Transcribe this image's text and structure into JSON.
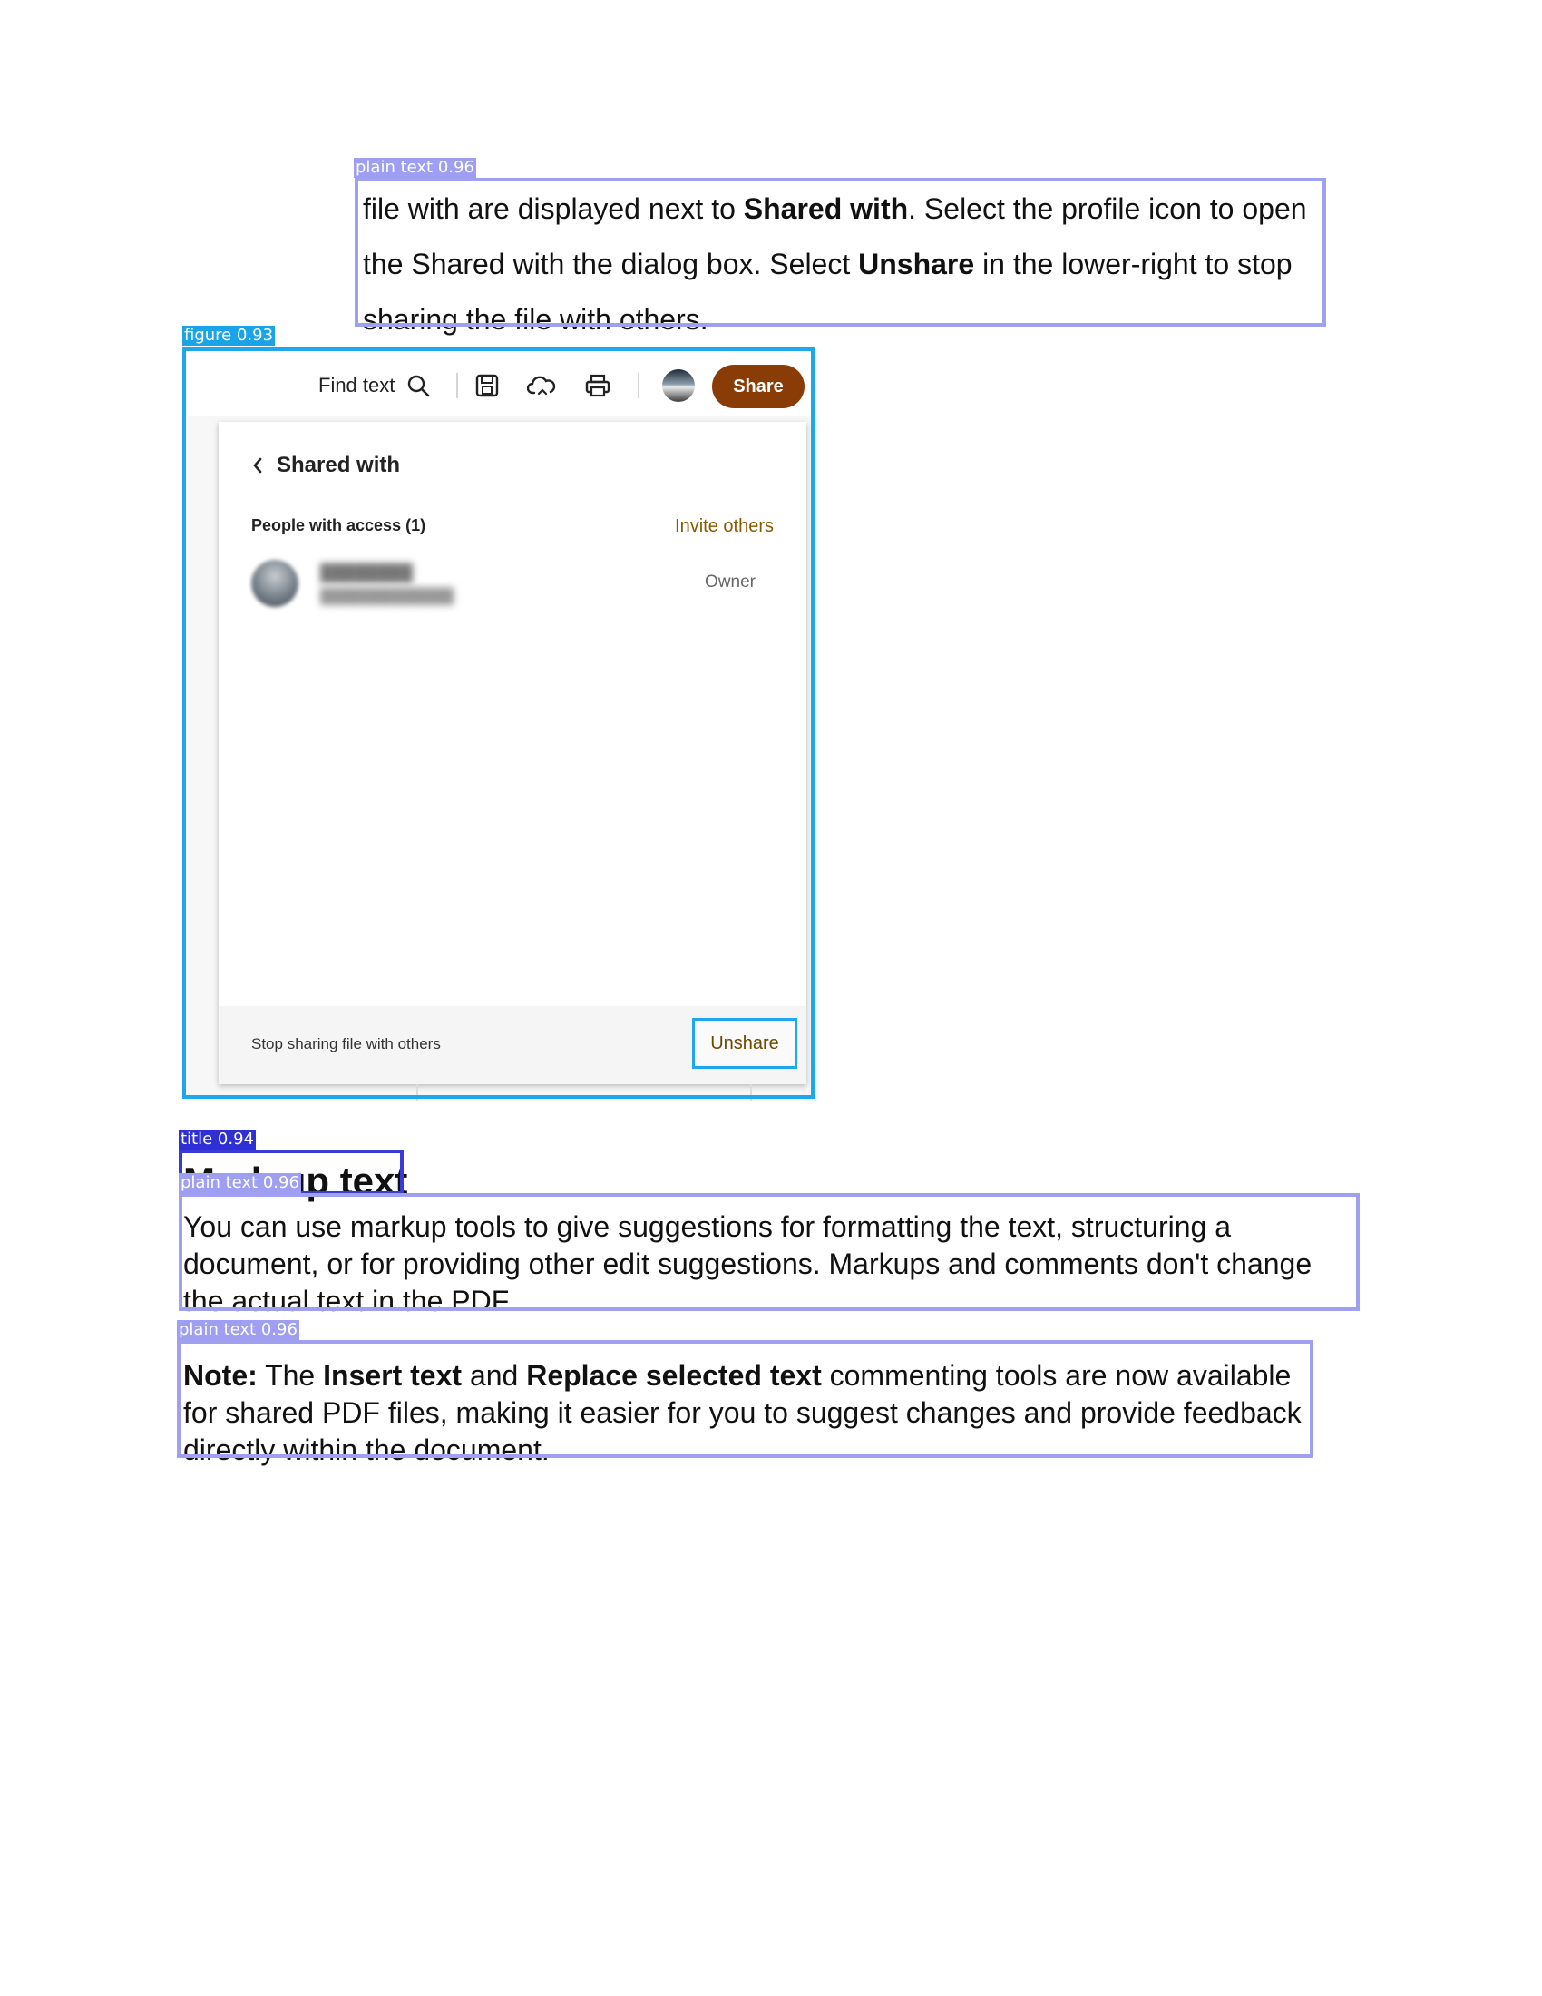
{
  "detections": {
    "paragraph_1": "plain text 0.96",
    "figure": "figure 0.93",
    "title": "title 0.94",
    "paragraph_2": "plain text 0.96",
    "paragraph_3": "plain text 0.96"
  },
  "paragraph_1": {
    "part1": "file with are displayed next to ",
    "bold1": "Shared with",
    "part2": ". Select the profile icon to open the Shared with the dialog box. Select ",
    "bold2": "Unshare",
    "part3": " in the lower-right to stop sharing the file with others."
  },
  "figure": {
    "toolbar": {
      "find_text": "Find text",
      "share_button": "Share",
      "icons": [
        "search-icon",
        "save-icon",
        "cloud-sync-icon",
        "print-icon"
      ]
    },
    "panel": {
      "title": "Shared with",
      "people_label": "People with access (1)",
      "invite_link": "Invite others",
      "owner_role": "Owner",
      "footer_text": "Stop sharing file with others",
      "unshare_button": "Unshare"
    }
  },
  "title": "Mark up text",
  "paragraph_2": "You can use markup tools to give suggestions for formatting the text, structuring a document, or for providing other edit suggestions. Markups and comments don't change the actual text in the PDF.",
  "paragraph_3": {
    "note_label": "Note:",
    "part1": " The ",
    "bold1": "Insert text",
    "part2": " and ",
    "bold2": "Replace selected text",
    "part3": " commenting tools are now available for shared PDF files, making it easier for you to suggest changes and provide feedback directly within the document."
  }
}
